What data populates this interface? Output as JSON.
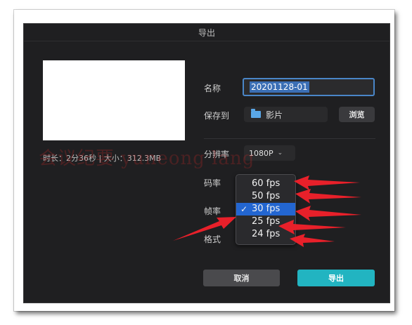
{
  "dialog": {
    "title": "导出",
    "meta": "时长：2分36秒 | 大小：312.3MB",
    "name_label": "名称",
    "name_value": "20201128-01",
    "save_to_label": "保存到",
    "folder_name": "影片",
    "browse_label": "浏览",
    "resolution_label": "分辨率",
    "resolution_value": "1080P",
    "bitrate_label": "码率",
    "framerate_label": "帧率",
    "format_label": "格式",
    "cancel_label": "取消",
    "export_label": "导出"
  },
  "dropdown": {
    "options": [
      {
        "label": "60 fps",
        "selected": false
      },
      {
        "label": "50 fps",
        "selected": false
      },
      {
        "label": "30 fps",
        "selected": true
      },
      {
        "label": "25 fps",
        "selected": false
      },
      {
        "label": "24 fps",
        "selected": false
      }
    ],
    "check": "✓"
  },
  "watermark": "会议纪要 yuneong lang",
  "colors": {
    "arrow": "#e8202a",
    "accent": "#22b4c1",
    "selection": "#2366d1"
  }
}
